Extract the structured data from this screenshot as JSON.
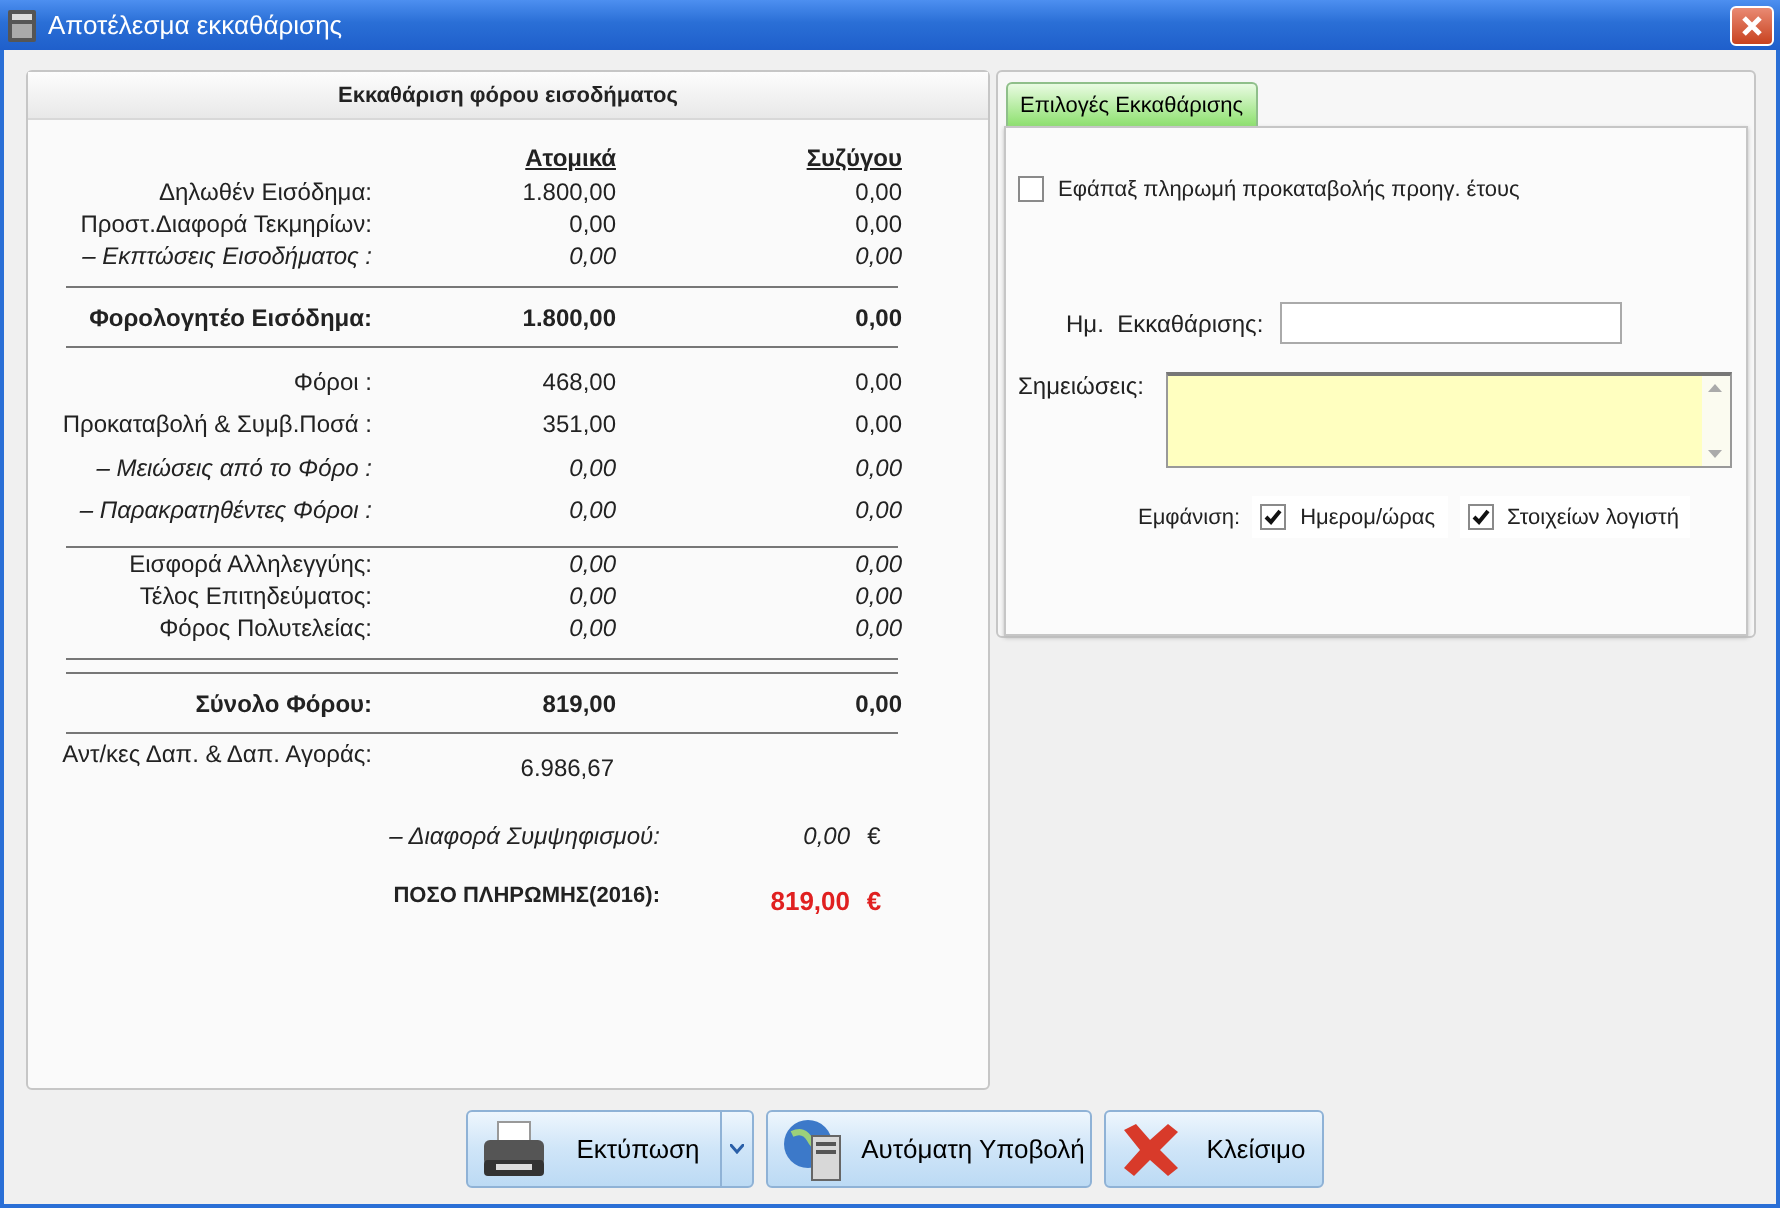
{
  "window": {
    "title": "Αποτέλεσμα εκκαθάρισης"
  },
  "settlement": {
    "title": "Εκκαθάριση φόρου εισοδήματος",
    "columns": [
      "Ατομικά",
      "Συζύγου"
    ],
    "groups": [
      {
        "kind": "detail",
        "rows": [
          {
            "label": "Δηλωθέν Εισόδημα:",
            "values": [
              "1.800,00",
              "0,00"
            ],
            "kind": "plain"
          },
          {
            "label": "Προστ.Διαφορά Τεκμηρίων:",
            "values": [
              "0,00",
              "0,00"
            ],
            "kind": "plain"
          },
          {
            "label": "– Εκπτώσεις Εισοδήματος  :",
            "values": [
              "0,00",
              "0,00"
            ],
            "kind": "deduction"
          }
        ]
      },
      {
        "kind": "total",
        "rows": [
          {
            "label": "Φορολογητέο Εισόδημα:",
            "values": [
              "1.800,00",
              "0,00"
            ],
            "kind": "total"
          }
        ]
      },
      {
        "kind": "tax",
        "rows": [
          {
            "label": "Φόροι :",
            "values": [
              "468,00",
              "0,00"
            ],
            "kind": "plain"
          },
          {
            "label": "Προκαταβολή & Συμβ.Ποσά :",
            "values": [
              "351,00",
              "0,00"
            ],
            "kind": "plain"
          },
          {
            "label": "– Μειώσεις από το Φόρο  :",
            "values": [
              "0,00",
              "0,00"
            ],
            "kind": "deduction"
          },
          {
            "label": "– Παρακρατηθέντες Φόροι  :",
            "values": [
              "0,00",
              "0,00"
            ],
            "kind": "deduction"
          }
        ]
      },
      {
        "kind": "detail",
        "rows": [
          {
            "label": "Εισφορά Αλληλεγγύης:",
            "values": [
              "0,00",
              "0,00"
            ],
            "kind": "levy"
          },
          {
            "label": "Τέλος Επιτηδεύματος:",
            "values": [
              "0,00",
              "0,00"
            ],
            "kind": "levy"
          },
          {
            "label": "Φόρος Πολυτελείας:",
            "values": [
              "0,00",
              "0,00"
            ],
            "kind": "levy"
          }
        ]
      },
      {
        "kind": "total",
        "rows": [
          {
            "label": "Σύνολο Φόρου:",
            "values": [
              "819,00",
              "0,00"
            ],
            "kind": "total"
          }
        ]
      }
    ],
    "offsets": {
      "label": "Αντ/κες Δαπ. & Δαπ. Αγοράς:",
      "value": "6.986,67"
    },
    "difference": {
      "label": "– Διαφορά Συμψηφισμού:",
      "value": "0,00",
      "currency": "€"
    },
    "payment": {
      "label": "ΠΟΣΟ ΠΛΗΡΩΜΗΣ(2016):",
      "value": "819,00",
      "currency": "€"
    }
  },
  "options": {
    "tabs": [
      {
        "label": "Επιλογές Εκκαθάρισης",
        "selected": true
      }
    ],
    "lump_sum": {
      "label": "Εφάπαξ πληρωμή προκαταβολής προηγ. έτους",
      "checked": false
    },
    "date": {
      "label": "Ημ.  Εκκαθάρισης:"
    },
    "notes": {
      "label": "Σημειώσεις:"
    },
    "display": {
      "label": "Εμφάνιση:",
      "options": [
        {
          "label": "Ημερομ/ώρας",
          "checked": true
        },
        {
          "label": "Στοιχείων λογιστή",
          "checked": true
        }
      ]
    }
  },
  "buttons": [
    {
      "label": "Εκτύπωση",
      "kind": "print"
    },
    {
      "label": "Αυτόματη Υποβολή",
      "kind": "submit"
    },
    {
      "label": "Κλείσιμο",
      "kind": "close"
    }
  ]
}
